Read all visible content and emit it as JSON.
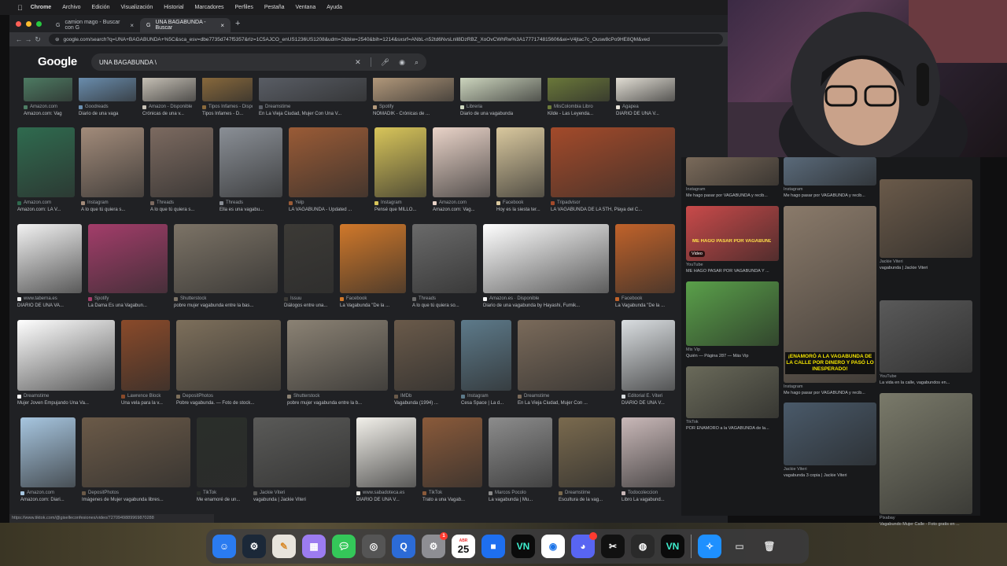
{
  "menubar": {
    "items": [
      "Chrome",
      "Archivo",
      "Edición",
      "Visualización",
      "Historial",
      "Marcadores",
      "Perfiles",
      "Pestaña",
      "Ventana",
      "Ayuda"
    ]
  },
  "tabs": [
    {
      "label": "camion mago - Buscar con G",
      "active": false
    },
    {
      "label": "UNA BAGABUNDA - Buscar",
      "active": true
    }
  ],
  "address": {
    "url": "google.com/search?q=UNA+BAGABUNDA+%5C&sca_esv=dbe7735d747f5357&rlz=1C5AJCO_enUS1236US1208&udm=2&biw=2540&bih=1214&sxsrf=ANbL-n52td6NvsLnll8DzRBZ_XoOvCWhRw%3A1777174815606&ei=V4jtac7c_Ousw8cPo9HE8QM&ved"
  },
  "google": {
    "logo": "Google",
    "query": "UNA BAGABUNDA \\"
  },
  "icons": {
    "search": "search-icon",
    "mic": "mic-icon",
    "lens": "lens-icon",
    "clear": "close-icon"
  },
  "results": [
    {
      "source": "Amazon.com",
      "title": "Amazon.com: Vag",
      "color": "#4e7d64"
    },
    {
      "source": "Goodreads",
      "title": "Diario de una vaga",
      "color": "#6b8fb0"
    },
    {
      "source": "Amazon - Disponible",
      "title": "Crónicas de una v...",
      "color": "#c9c3b8"
    },
    {
      "source": "Tipos Infames - Disponible",
      "title": "Tipos Infames - D...",
      "color": "#8a6a3c"
    },
    {
      "source": "Dreamstime",
      "title": "En La Vieja Ciudad, Mujer Con Una V...",
      "color": "#5a5e66"
    },
    {
      "source": "Spotify",
      "title": "NOMADIK - Crónicas de ...",
      "color": "#b49a7c"
    },
    {
      "source": "Libreria",
      "title": "Diario de una vagabunda",
      "color": "#cfd8c0"
    },
    {
      "source": "MisColombia Libro",
      "title": "Kilde - Las Leyenda...",
      "color": "#6c7a3a"
    },
    {
      "source": "Agapea",
      "title": "DIARIO DE UNA V...",
      "color": "#e6e2d8"
    },
    {
      "source": "Amazon.com",
      "title": "Amazon.com: LA V...",
      "color": "#2f6b4f"
    },
    {
      "source": "Instagram",
      "title": "A lo que tú quiera s...",
      "color": "#a28b7a"
    },
    {
      "source": "Threads",
      "title": "A lo que tú quiera s...",
      "color": "#7c6a60"
    },
    {
      "source": "Threads",
      "title": "Ella es una vagabu...",
      "color": "#8a8f96"
    },
    {
      "source": "Yelp",
      "title": "LA VAGABUNDA - Updated ...",
      "color": "#9a5b36"
    },
    {
      "source": "Instagram",
      "title": "Pensé que MILLO...",
      "color": "#d8c55a"
    },
    {
      "source": "Amazon.com",
      "title": "Amazon.com: Vag...",
      "color": "#e9d3c8"
    },
    {
      "source": "Facebook",
      "title": "Hoy es la siesta ter...",
      "color": "#d9c89e"
    },
    {
      "source": "Tripadvisor",
      "title": "LA VAGABUNDA DE LA 5TH, Playa del C...",
      "color": "#a34a2a"
    },
    {
      "source": "www.taberna.es",
      "title": "DIARIO DE UNA VA...",
      "color": "#f2f2f2"
    },
    {
      "source": "Spotify",
      "title": "La Dama Es una Vagabun...",
      "color": "#a33d6a"
    },
    {
      "source": "Shutterstock",
      "title": "pobre mujer vagabunda entre la bas...",
      "color": "#7c7366"
    },
    {
      "source": "Issuu",
      "title": "Diálogos entre una...",
      "color": "#3c3a36"
    },
    {
      "source": "Facebook",
      "title": "La Vagabunda \"De la ...",
      "color": "#d0782a"
    },
    {
      "source": "Threads",
      "title": "A lo que tú quiera so...",
      "color": "#6a6a6a"
    },
    {
      "source": "Amazon.es · Disponible",
      "title": "Diario de una vagabunda by Hayashi, Fumik...",
      "color": "#ffffff"
    },
    {
      "source": "Facebook",
      "title": "La Vagabunda \"De la ...",
      "color": "#c0622a"
    },
    {
      "source": "Dreamstime",
      "title": "Mujer Joven Empujando Una Va...",
      "color": "#ffffff"
    },
    {
      "source": "Lawrence Block",
      "title": "Una vela para la v...",
      "color": "#8a4a2a"
    },
    {
      "source": "DepositPhotos",
      "title": "Pobre vagabunda. — Foto de stock...",
      "color": "#7d6f5b"
    },
    {
      "source": "Shutterstock",
      "title": "pobre mujer vagabunda entre la b...",
      "color": "#8b8274"
    },
    {
      "source": "IMDb",
      "title": "Vagabunda (1994) ...",
      "color": "#6a5a4a"
    },
    {
      "source": "Instagram",
      "title": "Cesa Space | La d...",
      "color": "#5d7a8a"
    },
    {
      "source": "Dreamstime",
      "title": "En La Vieja Ciudad, Mujer Con ...",
      "color": "#7a6a5a"
    },
    {
      "source": "Editorial E. Viteri",
      "title": "DIARIO DE UNA V...",
      "color": "#d9dde0"
    },
    {
      "source": "Amazon.com",
      "title": "Amazon.com: Diari...",
      "color": "#a7c6e0"
    },
    {
      "source": "DepositPhotos",
      "title": "Imágenes de Mujer vagabunda libres...",
      "color": "#6b5a48"
    },
    {
      "source": "TikTok",
      "title": "Me enamoré de un...",
      "color": "#2a2e2a"
    },
    {
      "source": "Jackie Viteri",
      "title": "vagabunda | Jackie Viteri",
      "color": "#5a5a58"
    },
    {
      "source": "www.sabadoteca.es",
      "title": "DIARIO DE UNA V...",
      "color": "#f2f0ea"
    },
    {
      "source": "TikTok",
      "title": "Trato a una Vagab...",
      "color": "#8a5a3a"
    },
    {
      "source": "Marcos Pocolo",
      "title": "La vagabunda | Mu...",
      "color": "#8c8c8c"
    },
    {
      "source": "Dreamstime",
      "title": "Escultura de la vag...",
      "color": "#7a6a4e"
    },
    {
      "source": "Todocoleccion",
      "title": "Libro La vagabund...",
      "color": "#c9b8b8"
    }
  ],
  "right_panel": [
    {
      "source": "Instagram",
      "title": "Me hago pasar por VAGABUNDA y recib...",
      "color": "#7a6a5a"
    },
    {
      "source": "Instagram",
      "title": "Me hago pasar por VAGABUNDA y recib...",
      "color": "#5a6a7a"
    },
    {
      "source": "Jackie Viteri",
      "title": "vagabunda | Jackie Viteri",
      "color": "#6a5a4a"
    },
    {
      "source": "YouTube",
      "title": "ME HAGO PASAR POR VAGABUNDA Y ...",
      "color": "#c94a4a"
    },
    {
      "source": "Mis Vip",
      "title": "Quién — Página 287 — Más Vip",
      "color": "#5aa04a"
    },
    {
      "source": "Instagram",
      "title": "Me hago pasar por VAGABUNDA y recib...",
      "color": "#8a7a6a"
    },
    {
      "source": "YouTube",
      "title": "La vida en la calle, vagabundos en...",
      "color": "#5a5a5a"
    },
    {
      "source": "TikTok",
      "title": "POR ENAMORÓ a la VAGABUNDA de la...",
      "color": "#6a6a5a"
    },
    {
      "source": "Jackie Viteri",
      "title": "vagabunda 3 copia | Jackie Viteri",
      "color": "#4a5a6a"
    },
    {
      "source": "Pixabay",
      "title": "Vagabundo Mujer Calle - Foto gratis en ...",
      "color": "#7a7a6a"
    }
  ],
  "right_text": {
    "headline": "¡ENAMORÓ A LA VAGABUNDA DE LA CALLE POR DINERO Y PASÓ LO INESPERADO!",
    "video_label": "Video",
    "thumb_text": "ME HAGO PASAR POR VAGABUNDA"
  },
  "status_url": "https://www.tiktok.com/@giselleconfesiones/video/7270949889969870288",
  "dock": {
    "apps": [
      "Finder",
      "Steam",
      "Pages",
      "Launchpad",
      "Messages",
      "Screenshot",
      "QuickTime",
      "Settings",
      "Calendar",
      "Roblox",
      "Zoom",
      "Chrome",
      "Discord",
      "CapCut",
      "OBS",
      "App",
      "Safari",
      "Trash"
    ],
    "calendar_day": "25",
    "calendar_month": "ABR",
    "settings_badge": "1"
  }
}
